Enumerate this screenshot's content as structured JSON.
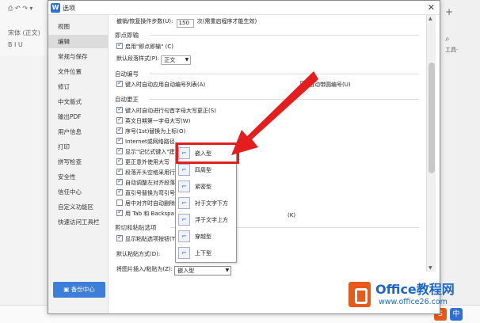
{
  "background_app": {
    "toolbar_font": "宋体 (正文)",
    "toolbar_style": "B  I  U",
    "right_tools_label": "工具·",
    "colors": {
      "wps_red": "#e8591a",
      "wps_blue": "#2f6fd6"
    }
  },
  "dialog": {
    "title": "选项",
    "close_icon": "close-icon",
    "sidebar": {
      "items": [
        {
          "label": "视图"
        },
        {
          "label": "编辑"
        },
        {
          "label": "常规与保存"
        },
        {
          "label": "文件位置"
        },
        {
          "label": "修订"
        },
        {
          "label": "中文版式"
        },
        {
          "label": "输出PDF"
        },
        {
          "label": "用户信息"
        },
        {
          "label": "打印"
        },
        {
          "label": "拼写检查"
        },
        {
          "label": "安全性"
        },
        {
          "label": "信任中心"
        },
        {
          "label": "自定义功能区"
        },
        {
          "label": "快速访问工具栏"
        }
      ],
      "active_index": 1,
      "backup_label": "备份中心"
    },
    "content": {
      "undo_label": "撤销/恢复操作步数(U):",
      "undo_value": "150",
      "undo_note": "次(需重启程序才能生效)",
      "section_clipboard": "即点即输",
      "enable_click_type": "启用\"即点即输\" (C)",
      "default_para_style_label": "默认段落样式(P):",
      "default_para_style_value": "正文",
      "section_autonumber": "自动编号",
      "auto_numbered_list": "键入时自动应用自动编号列表(A)",
      "auto_bullet": "自动带圆编号(U)",
      "section_autocorrect": "自动更正",
      "ac_items": [
        "键入时自动进行句首字母大写更正(S)",
        "英文日期第一字母大写(W)",
        "序号(1st)替换为上标(O)",
        "Internet或网络路径",
        "显示\"记忆式键入\"建",
        "更正意外使用大写",
        "段落开头空格采用行",
        "自动调整左对齐段落",
        "直引号替换为弯引号",
        "居中对齐时自动删除",
        "用 Tab 和 Backspa"
      ],
      "ac_item_tail": "(K)",
      "section_paste": "剪切和粘贴选项",
      "show_paste_options": "显示粘贴选项按钮(T",
      "default_paste_label": "默认粘贴方式(D):",
      "insert_picture_label": "将图片插入/粘贴为(Z):",
      "insert_picture_value": "嵌入型"
    },
    "dropdown": {
      "options": [
        {
          "label": "嵌入型",
          "icon": "inline-wrap-icon"
        },
        {
          "label": "四周型",
          "icon": "square-wrap-icon"
        },
        {
          "label": "紧密型",
          "icon": "tight-wrap-icon"
        },
        {
          "label": "衬于文字下方",
          "icon": "behind-text-icon"
        },
        {
          "label": "浮于文字上方",
          "icon": "in-front-text-icon"
        },
        {
          "label": "穿越型",
          "icon": "through-wrap-icon"
        },
        {
          "label": "上下型",
          "icon": "top-bottom-wrap-icon"
        }
      ],
      "selected": "嵌入型"
    }
  },
  "watermark": {
    "title": "Office教程网",
    "url": "www.office26.com"
  }
}
